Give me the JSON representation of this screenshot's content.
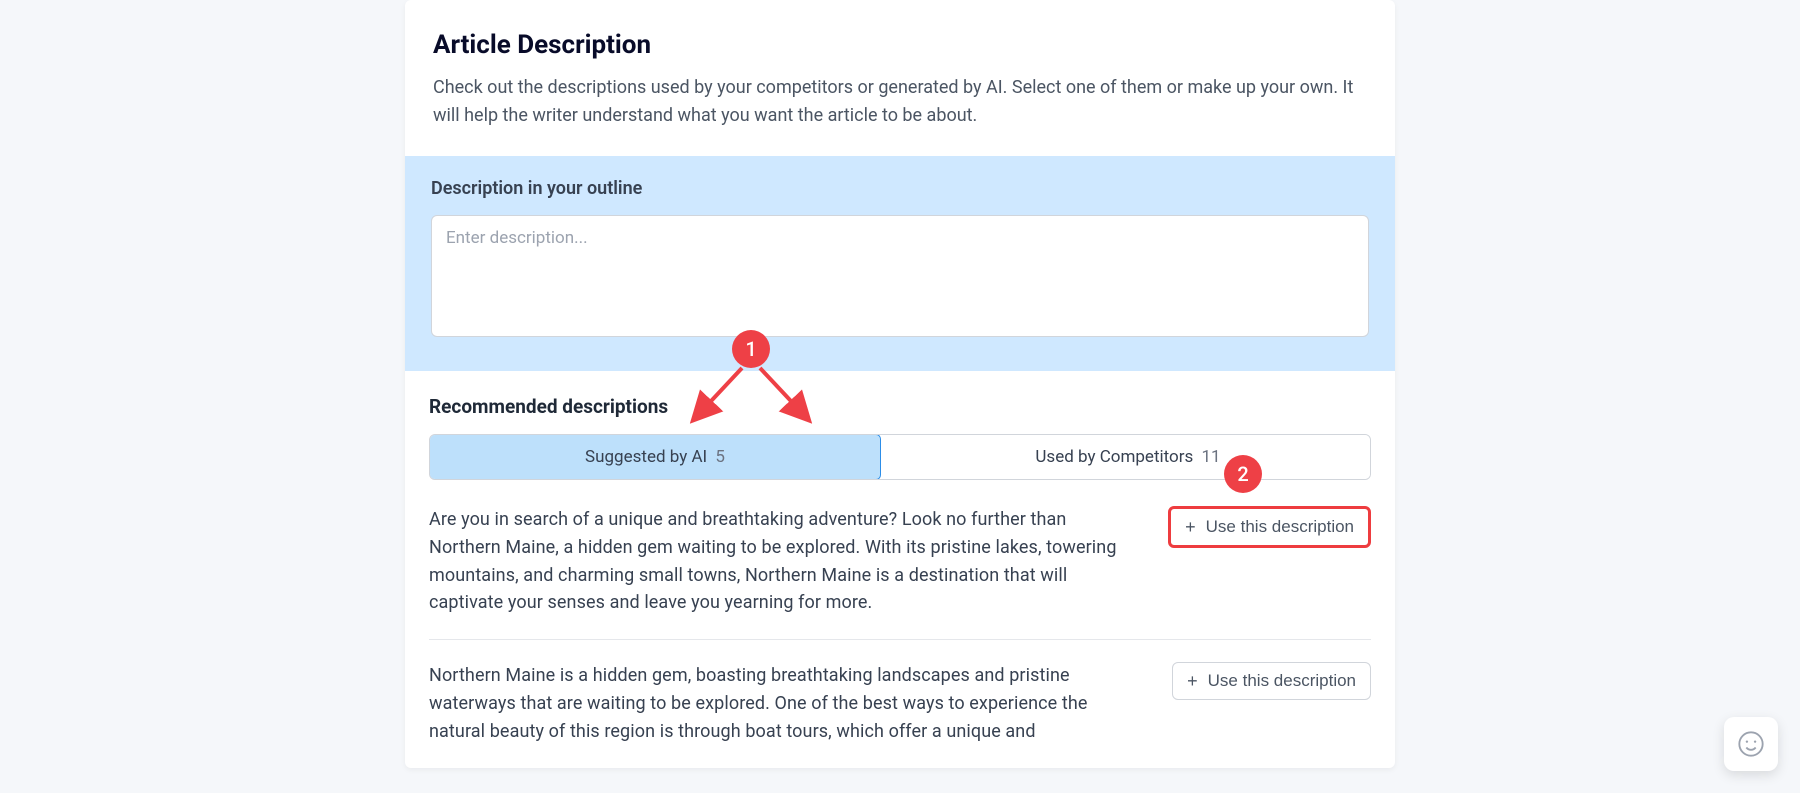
{
  "header": {
    "title": "Article Description",
    "subtitle": "Check out the descriptions used by your competitors or generated by AI. Select one of them or make up your own. It will help the writer understand what you want the article to be about."
  },
  "outline": {
    "label": "Description in your outline",
    "placeholder": "Enter description..."
  },
  "recommended": {
    "title": "Recommended descriptions",
    "tabs": [
      {
        "label": "Suggested by AI",
        "count": "5"
      },
      {
        "label": "Used by Competitors",
        "count": "11"
      }
    ]
  },
  "descriptions": [
    {
      "text": "Are you in search of a unique and breathtaking adventure? Look no further than Northern Maine, a hidden gem waiting to be explored. With its pristine lakes, towering mountains, and charming small towns, Northern Maine is a destination that will captivate your senses and leave you yearning for more.",
      "button": "Use this description"
    },
    {
      "text": "Northern Maine is a hidden gem, boasting breathtaking landscapes and pristine waterways that are waiting to be explored. One of the best ways to experience the natural beauty of this region is through boat tours, which offer a unique and",
      "button": "Use this description"
    }
  ],
  "annotations": {
    "badge1": "1",
    "badge2": "2"
  }
}
